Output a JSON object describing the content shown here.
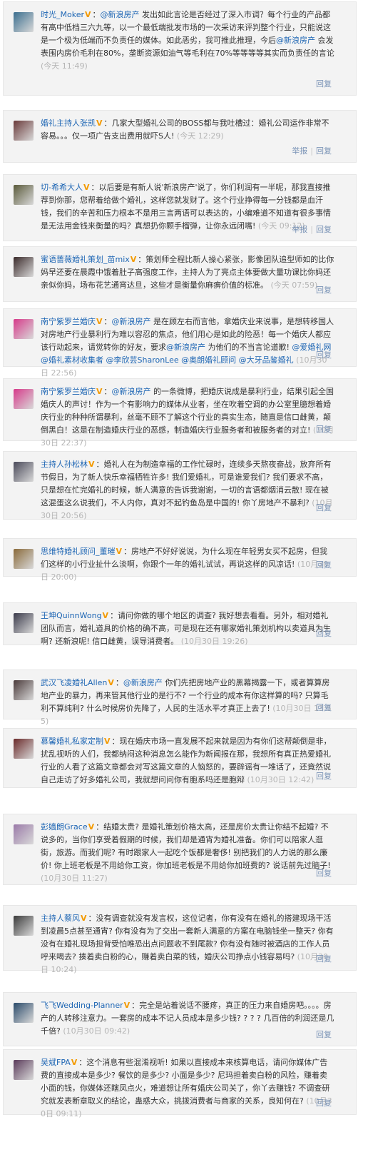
{
  "comments": [
    {
      "user": "时光_Moker",
      "avatar_color": "#3b6f8f",
      "text": "：@新浪房产 发出如此言论是否经过了深入市调？每个行业的产品都有高中低档三六九等，以一个最低端批发市场的一次采访来评判整个行业，只能说这是一个极为低端而不负责任的媒体。如此恶劣，我可推此推理，今后@新浪房产 会发表围内房价毛利在80%，垄断资源如油气等毛利在70%等等等等其实而负责任的言论",
      "time": "(今天 11:49)",
      "actions": [
        "回复"
      ]
    },
    {
      "user": "婚礼主持人张凯",
      "avatar_color": "#6b3a3a",
      "text": "：几家大型婚礼公司的BOSS都与我吐槽过：婚礼公司运作非常不容易。。。仅一项广告支出费用就吓S人!",
      "time": "(今天 12:29)",
      "actions": [
        "举报",
        "回复"
      ]
    },
    {
      "user": "切-希希大人",
      "avatar_color": "#5a5a3a",
      "text": "：以后要是有新人说'新浪房产'说了，你们利润有一半呢，那我直接推荐到你那，您帮着给做个婚礼，这样您就发财了。这个行业挣得每一分钱都是血汗钱，我们的辛苦和压力根本不是用三言两语可以表达的，小编难道不知道有很多事情是无法用金钱来衡量的吗？真想扔你颗手榴弹，让你永远闭嘴!",
      "time": "(今天 09:12)",
      "actions": [
        "举报",
        "回复"
      ]
    },
    {
      "user": "蜜语蔷薇婚礼策划_苗mix",
      "avatar_color": "#3a2a2a",
      "text": "：策划师全程比新人操心紧张，影像团队追型师如的比你妈早还要在晨霞中饿着肚子高强度工作，主持人为了亮点主体要做大量功课比你妈还亲似你妈，场布花艺通宵达旦，这些才是衡量你麻痹价值的标准。",
      "time": "(今天 07:59)",
      "actions": [
        "回复"
      ]
    },
    {
      "user": "南宁紫罗兰婚庆",
      "avatar_color": "#d63a8a",
      "text": "：@新浪房产 是在顾左右而言他，拿婚庆业来说事，是想转移国人对房地产行业暴利行为难以容忍的焦点，他们用心是如此的险恶！每一个婚庆人都应该行动起来，请觉转你的好友，要求@新浪房产 为他们的不当言论道歉! @爱婚礼网 @婚礼素材收集者 @李欣芸SharonLee @奥朗婚礼顾问 @大牙品鉴婚礼",
      "time": "(10月30日 22:56)",
      "actions": [
        "回复"
      ]
    },
    {
      "user": "南宁紫罗兰婚庆",
      "avatar_color": "#d63a8a",
      "text": "：@新浪房产 的一条微博，把婚庆说成是暴利行业，结果引起全国婚庆人的声讨！作为一个有影响力的媒体从业者，坐在吹着空调的办公室里臆想着婚庆行业的种种所谓暴利，丝毫不顾不了解这个行业的真实生态，随直是信口雌黄，颠倒黑白！这是在制造婚庆行业的恶感，制造婚庆行业服务者和被服务者的对立!",
      "time": "(10月30日 22:37)",
      "actions": [
        "回复"
      ]
    },
    {
      "user": "主持人孙松林",
      "avatar_color": "#4a4a5a",
      "text": "：婚礼人在为制造幸福的工作忙碌时，连续多天熬夜奋战，放弃所有节假日，为了新人快乐幸福牺牲许多! 我们爱婚礼，可是谁爱我们? 我们要求不高，只是想在忙完婚礼的时候，新人满意的告诉我谢谢，一切的言语都烟消云散! 现在被这混蛋这么说我们，不人内你，真对不起钓鱼岛是中国的! 你丫房地产不暴利?",
      "time": "(10月30日 20:56)",
      "actions": [
        "回复"
      ]
    },
    {
      "user": "思维特婚礼顾问_董璀",
      "avatar_color": "#8a6a3a",
      "text": "：房地产不好好说说，为什么现在年轻男女买不起房，但我们这样的小行业扯什么淡啊，你跟个一年的婚礼试试，再说这样的风凉话!",
      "time": "(10月30日 20:00)",
      "actions": [
        "回复"
      ]
    },
    {
      "user": "王坤QuinnWong",
      "avatar_color": "#3a3a4a",
      "text": "：请问你做的哪个地区的调查? 我好想去看看。另外，相对婚礼团队而言，婚礼道具的价格的确不高，可是现在还有哪家婚礼策划机构以卖道具为生啊? 还新浪呢! 信口雌黄，误导消费者。",
      "time": "(10月30日 19:26)",
      "actions": [
        "回复"
      ]
    },
    {
      "user": "武汉飞凌婚礼Allen",
      "avatar_color": "#4a3a3a",
      "text": "：@新浪房产 你们先把房地产业的黑幕揭露一下，或者算算房地产业的暴力，再来管其他行业的是行不? 一个行业的成本有你这样算的吗? 只算毛利不算纯利? 什么时候房价先降了，人民的生活水平才真正上去了!",
      "time": "(10月30日 13:55)",
      "actions": [
        "回复"
      ]
    },
    {
      "user": "慕馨婚礼私家定制",
      "avatar_color": "#6a2a2a",
      "text": "：现在婚庆市场一直发展不起来就是因为有你们这帮颠倒是非，扰乱视听的人们，我都纳闷这种消息怎么能作为新闻报在那，我想所有真正热爱婚礼行业的人看了这篇文章都会对写这篇文章的人恼怒的，要辟谣有一堆话了，还竟然说自己走访了好多婚礼公司，我就想问问你有胞系吗还是胞辩",
      "time": "(10月30日 12:42)",
      "actions": [
        "回复"
      ]
    },
    {
      "user": "彭嫱朗Grace",
      "avatar_color": "#9a7aa8",
      "text": "：结婚太贵? 是婚礼策划价格太高，还是房价太贵让你结不起婚? 不说多的，当你们享受着假期的时候，我们却是通宵为婚礼准备。你们可以陪家人逛街，旅游。而我们呢? 有时跟家人一起吃个饭都是奢侈! 别把我们的人力说的那么廉价! 你上班老板是不用给你工资，你加班老板是不用给你加班费的? 说话前先过脑子!",
      "time": "(10月30日 11:27)",
      "actions": [
        "回复"
      ]
    },
    {
      "user": "主持人蔡风",
      "avatar_color": "#3a3a3a",
      "text": "：没有调查就没有发言权，这位记者，你有没有在婚礼的搭建现场干活到凌晨5点甚至通宵? 你有没有为了交出一套新人满意的方案在电脑钱坐一整天? 你有没有在婚礼现场担背受怕唯恐出点问题收不到尾款? 你有没有随时被酒店的工作人员呼来喝去? 揍着卖白粉的心，赚着卖白菜的钱，婚庆公司挣点小钱容易吗?",
      "time": "(10月30日 10:24)",
      "actions": [
        "回复"
      ]
    },
    {
      "user": "飞飞Wedding-Planner",
      "avatar_color": "#2a4a6a",
      "text": "：完全是站着说话不腰疼，真正的压力来自婚房吧。。。。房产的人转移注意力。一套房的成本不记人员成本是多少钱? ? ? ? 几百倍的利润还是几千倍?",
      "time": "(10月30日 09:42)",
      "actions": [
        "回复"
      ]
    },
    {
      "user": "吴斌FPA",
      "avatar_color": "#5a3a5a",
      "text": "：这个消息有些混淆视听! 如果以直接成本来核算电话，请问你媒体广告费的直接成本是多少? 餐饮的是多少? 小面是多少? 尼玛担着卖白粉的风险，赚着卖小面的钱，你媒体还瞎凤点火，难道想让所有婚庆公司关了，你丫去赚钱? 不调查研究就发表断章取义的结论，蛊惑大众，挑拨消费者与商家的关系，良知何在?",
      "time": "(10月30日 09:11)",
      "actions": [
        "回复"
      ]
    }
  ]
}
